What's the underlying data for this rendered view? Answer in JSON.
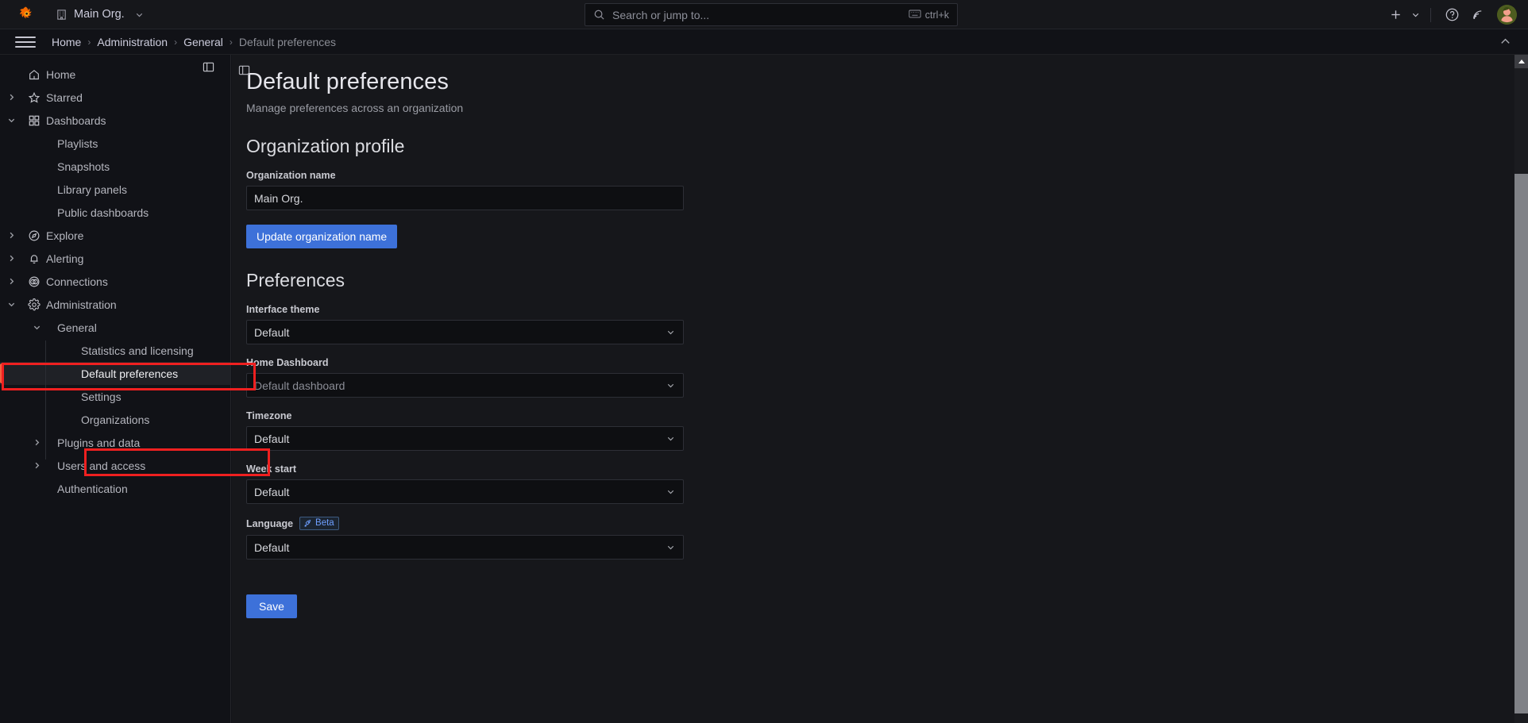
{
  "topbar": {
    "logo_icon": "grafana-logo",
    "org_icon": "building-icon",
    "org_label": "Main Org.",
    "org_chevron_icon": "chevron-down-icon",
    "search": {
      "icon": "search-icon",
      "placeholder": "Search or jump to...",
      "kbd_icon": "keyboard-icon",
      "shortcut": "ctrl+k"
    },
    "actions": {
      "plus_icon": "plus-icon",
      "plus_chevron_icon": "chevron-down-icon",
      "help_icon": "help-circle-icon",
      "news_icon": "rss-news-icon",
      "avatar_icon": "user-avatar"
    }
  },
  "breadcrumbbar": {
    "menu_icon": "hamburger-menu-icon",
    "separator": "›",
    "collapse_icon": "chevron-up-icon",
    "items": [
      {
        "label": "Home",
        "current": false
      },
      {
        "label": "Administration",
        "current": false
      },
      {
        "label": "General",
        "current": false
      },
      {
        "label": "Default preferences",
        "current": true
      }
    ]
  },
  "sidebar": {
    "dock_icon": "dock-panel-icon",
    "items": [
      {
        "label": "Home",
        "icon": "home-icon",
        "level": 0,
        "expander": "none"
      },
      {
        "label": "Starred",
        "icon": "star-icon",
        "level": 0,
        "expander": "right"
      },
      {
        "label": "Dashboards",
        "icon": "dashboards-grid-icon",
        "level": 0,
        "expander": "down"
      },
      {
        "label": "Playlists",
        "icon": "",
        "level": 1,
        "expander": "none"
      },
      {
        "label": "Snapshots",
        "icon": "",
        "level": 1,
        "expander": "none"
      },
      {
        "label": "Library panels",
        "icon": "",
        "level": 1,
        "expander": "none"
      },
      {
        "label": "Public dashboards",
        "icon": "",
        "level": 1,
        "expander": "none"
      },
      {
        "label": "Explore",
        "icon": "compass-icon",
        "level": 0,
        "expander": "right"
      },
      {
        "label": "Alerting",
        "icon": "bell-icon",
        "level": 0,
        "expander": "right"
      },
      {
        "label": "Connections",
        "icon": "connections-icon",
        "level": 0,
        "expander": "right"
      },
      {
        "label": "Administration",
        "icon": "gear-icon",
        "level": 0,
        "expander": "down",
        "highlighted": true
      },
      {
        "label": "General",
        "icon": "",
        "level": 1,
        "expander": "down"
      },
      {
        "label": "Statistics and licensing",
        "icon": "",
        "level": 2,
        "expander": "none"
      },
      {
        "label": "Default preferences",
        "icon": "",
        "level": 2,
        "expander": "none",
        "active": true,
        "highlighted": true
      },
      {
        "label": "Settings",
        "icon": "",
        "level": 2,
        "expander": "none"
      },
      {
        "label": "Organizations",
        "icon": "",
        "level": 2,
        "expander": "none"
      },
      {
        "label": "Plugins and data",
        "icon": "",
        "level": 1,
        "expander": "right"
      },
      {
        "label": "Users and access",
        "icon": "",
        "level": 1,
        "expander": "right"
      },
      {
        "label": "Authentication",
        "icon": "",
        "level": 1,
        "expander": "none"
      }
    ]
  },
  "main": {
    "dock_icon": "dock-panel-icon",
    "title": "Default preferences",
    "subtitle": "Manage preferences across an organization",
    "org_profile": {
      "heading": "Organization profile",
      "org_name_label": "Organization name",
      "org_name_value": "Main Org.",
      "update_button": "Update organization name"
    },
    "preferences": {
      "heading": "Preferences",
      "fields": [
        {
          "label": "Interface theme",
          "value": "Default",
          "placeholder": false,
          "control": "select"
        },
        {
          "label": "Home Dashboard",
          "value": "Default dashboard",
          "placeholder": true,
          "control": "select"
        },
        {
          "label": "Timezone",
          "value": "Default",
          "placeholder": false,
          "control": "select"
        },
        {
          "label": "Week start",
          "value": "Default",
          "placeholder": false,
          "control": "select"
        },
        {
          "label": "Language",
          "value": "Default",
          "placeholder": false,
          "control": "select",
          "badge": "Beta",
          "badge_icon": "rocket-icon"
        }
      ],
      "save_button": "Save"
    }
  },
  "scrollbar": {
    "up_icon": "scroll-up-arrow",
    "down_icon": "scroll-down-arrow"
  },
  "colors": {
    "accent_orange": "#f55f3e",
    "primary_blue": "#3d71d9",
    "annotation_red": "#ef2020",
    "page_bg": "#111217",
    "content_bg": "#16171b"
  }
}
